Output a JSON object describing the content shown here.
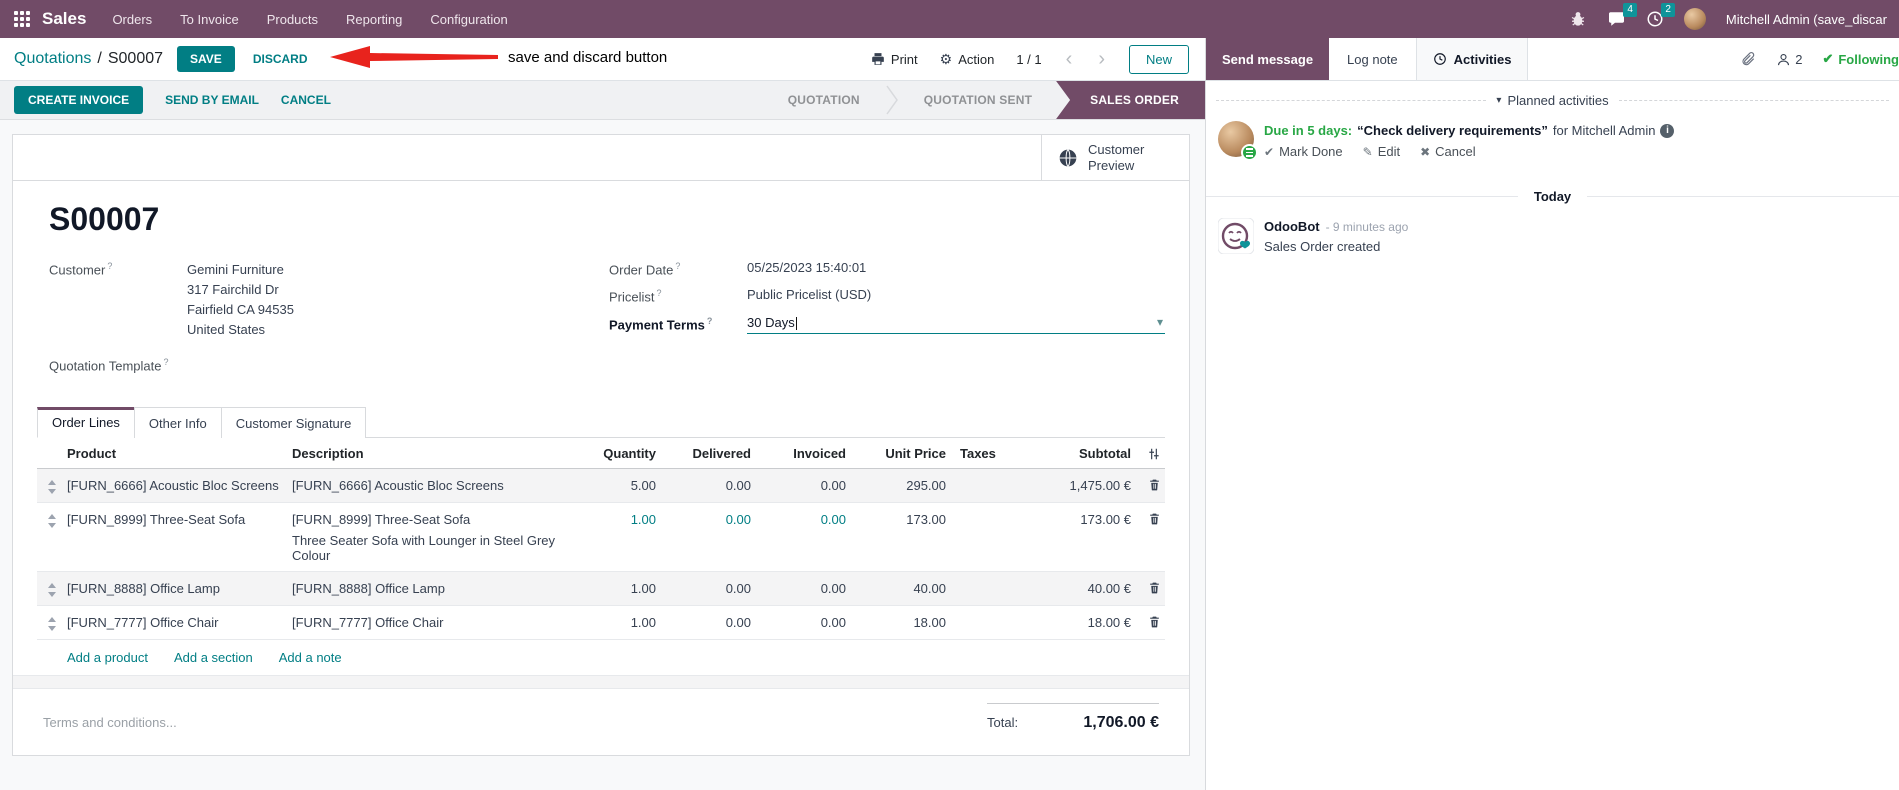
{
  "colors": {
    "brand_purple": "#714B67",
    "accent_teal": "#017e84",
    "green": "#28a745",
    "arrow_red": "#e8231d"
  },
  "icons": {
    "gear": "⚙",
    "check": "✔",
    "pencil": "✎",
    "cross": "✖",
    "caret_down": "▾",
    "chevron_left": "‹",
    "chevron_right": "›",
    "question": "?",
    "info": "i"
  },
  "nav": {
    "app_name": "Sales",
    "menus": [
      "Orders",
      "To Invoice",
      "Products",
      "Reporting",
      "Configuration"
    ],
    "message_badge": "4",
    "activity_badge": "2",
    "user_name": "Mitchell Admin (save_discar"
  },
  "control": {
    "breadcrumb_parent": "Quotations",
    "breadcrumb_sep": "/",
    "breadcrumb_current": "S00007",
    "save": "SAVE",
    "discard": "DISCARD",
    "annotation": "save and discard button",
    "print": "Print",
    "action": "Action",
    "pager": "1 / 1",
    "new": "New"
  },
  "statusbar": {
    "create_invoice": "CREATE INVOICE",
    "send_by_email": "SEND BY EMAIL",
    "cancel": "CANCEL",
    "stages": [
      {
        "label": "QUOTATION",
        "active": false
      },
      {
        "label": "QUOTATION SENT",
        "active": false
      },
      {
        "label": "SALES ORDER",
        "active": true
      }
    ]
  },
  "sheet": {
    "customer_preview": "Customer Preview",
    "title": "S00007",
    "fields": {
      "customer_label": "Customer",
      "customer_name": "Gemini Furniture",
      "customer_street": "317 Fairchild Dr",
      "customer_city": "Fairfield CA 94535",
      "customer_country": "United States",
      "quotation_template_label": "Quotation Template",
      "order_date_label": "Order Date",
      "order_date_value": "05/25/2023 15:40:01",
      "pricelist_label": "Pricelist",
      "pricelist_value": "Public Pricelist (USD)",
      "payment_terms_label": "Payment Terms",
      "payment_terms_value": "30 Days"
    },
    "tabs": [
      "Order Lines",
      "Other Info",
      "Customer Signature"
    ],
    "table": {
      "headers": [
        "Product",
        "Description",
        "Quantity",
        "Delivered",
        "Invoiced",
        "Unit Price",
        "Taxes",
        "Subtotal"
      ],
      "rows": [
        {
          "product": "[FURN_6666] Acoustic Bloc Screens",
          "description": "[FURN_6666] Acoustic Bloc Screens",
          "quantity": "5.00",
          "delivered": "0.00",
          "invoiced": "0.00",
          "unit_price": "295.00",
          "taxes": "",
          "subtotal": "1,475.00 €"
        },
        {
          "product": "[FURN_8999] Three-Seat Sofa",
          "description": "[FURN_8999] Three-Seat Sofa",
          "description2": "Three Seater Sofa with Lounger in Steel Grey Colour",
          "quantity": "1.00",
          "delivered": "0.00",
          "invoiced": "0.00",
          "unit_price": "173.00",
          "taxes": "",
          "subtotal": "173.00 €"
        },
        {
          "product": "[FURN_8888] Office Lamp",
          "description": "[FURN_8888] Office Lamp",
          "quantity": "1.00",
          "delivered": "0.00",
          "invoiced": "0.00",
          "unit_price": "40.00",
          "taxes": "",
          "subtotal": "40.00 €"
        },
        {
          "product": "[FURN_7777] Office Chair",
          "description": "[FURN_7777] Office Chair",
          "quantity": "1.00",
          "delivered": "0.00",
          "invoiced": "0.00",
          "unit_price": "18.00",
          "taxes": "",
          "subtotal": "18.00 €"
        }
      ],
      "footer_links": [
        "Add a product",
        "Add a section",
        "Add a note"
      ]
    },
    "terms_placeholder": "Terms and conditions...",
    "total_label": "Total:",
    "total_value": "1,706.00 €"
  },
  "chatter": {
    "send_message": "Send message",
    "log_note": "Log note",
    "activities_tab": "Activities",
    "followers_count": "2",
    "following": "Following",
    "planned_header": "Planned activities",
    "activity": {
      "due": "Due in 5 days:",
      "summary": "“Check delivery requirements”",
      "assignee": "for Mitchell Admin",
      "mark_done": "Mark Done",
      "edit": "Edit",
      "cancel": "Cancel"
    },
    "today": "Today",
    "message": {
      "author": "OdooBot",
      "time": "- 9 minutes ago",
      "body": "Sales Order created"
    }
  }
}
